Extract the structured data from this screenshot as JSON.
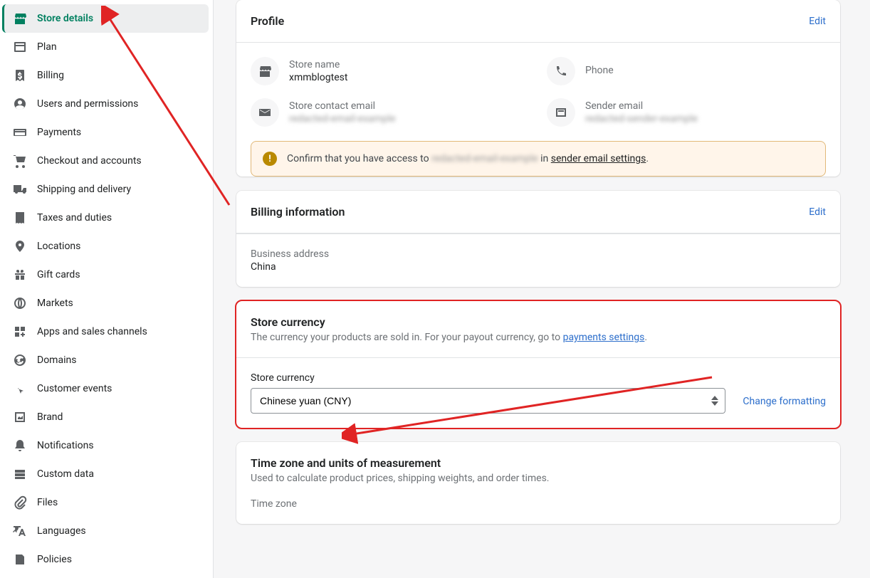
{
  "sidebar": {
    "items": [
      {
        "label": "Store details"
      },
      {
        "label": "Plan"
      },
      {
        "label": "Billing"
      },
      {
        "label": "Users and permissions"
      },
      {
        "label": "Payments"
      },
      {
        "label": "Checkout and accounts"
      },
      {
        "label": "Shipping and delivery"
      },
      {
        "label": "Taxes and duties"
      },
      {
        "label": "Locations"
      },
      {
        "label": "Gift cards"
      },
      {
        "label": "Markets"
      },
      {
        "label": "Apps and sales channels"
      },
      {
        "label": "Domains"
      },
      {
        "label": "Customer events"
      },
      {
        "label": "Brand"
      },
      {
        "label": "Notifications"
      },
      {
        "label": "Custom data"
      },
      {
        "label": "Files"
      },
      {
        "label": "Languages"
      },
      {
        "label": "Policies"
      }
    ]
  },
  "profile": {
    "title": "Profile",
    "edit": "Edit",
    "store_name_label": "Store name",
    "store_name_value": "xmmblogtest",
    "phone_label": "Phone",
    "phone_value": "",
    "contact_email_label": "Store contact email",
    "contact_email_value": "redacted-email-example",
    "sender_email_label": "Sender email",
    "sender_email_value": "redacted-sender-example"
  },
  "banner": {
    "prefix": "Confirm that you have access to ",
    "email": "redacted-email-example",
    "middle": " in ",
    "link": "sender email settings",
    "suffix": "."
  },
  "billing": {
    "title": "Billing information",
    "edit": "Edit",
    "address_label": "Business address",
    "address_value": "China"
  },
  "currency": {
    "title": "Store currency",
    "desc_prefix": "The currency your products are sold in. For your payout currency, go to ",
    "desc_link": "payments settings",
    "desc_suffix": ".",
    "field_label": "Store currency",
    "selected": "Chinese yuan (CNY)",
    "change_link": "Change formatting"
  },
  "timezone": {
    "title": "Time zone and units of measurement",
    "desc": "Used to calculate product prices, shipping weights, and order times.",
    "field_label": "Time zone"
  }
}
